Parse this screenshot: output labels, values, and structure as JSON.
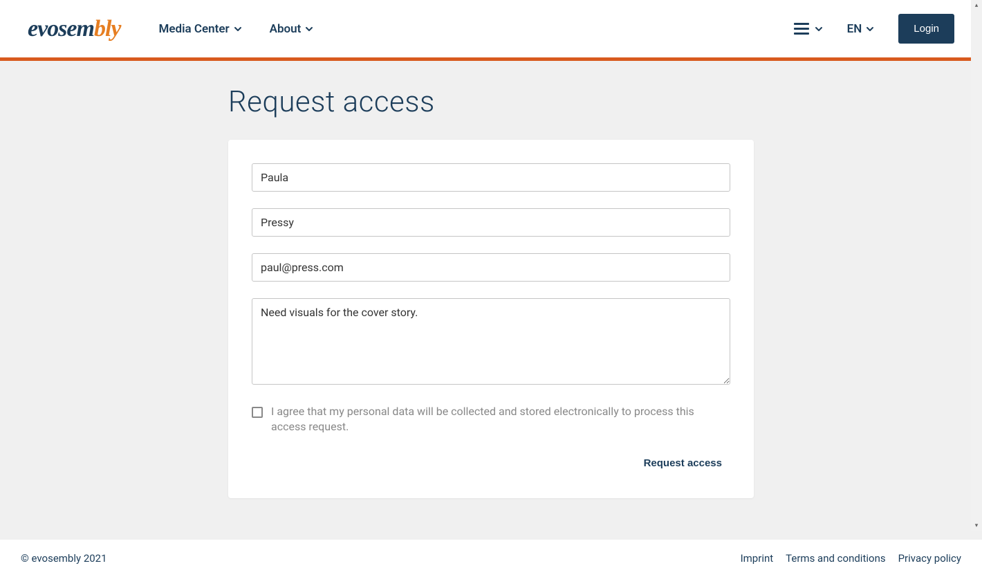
{
  "brand": {
    "part1": "evosem",
    "part2": "bly"
  },
  "nav": {
    "media": "Media Center",
    "about": "About"
  },
  "lang": "EN",
  "login": "Login",
  "page": {
    "title": "Request access"
  },
  "form": {
    "firstname": "Paula",
    "lastname": "Pressy",
    "email": "paul@press.com",
    "message": "Need visuals for the cover story.",
    "consent_label": "I agree that my personal data will be collected and stored electronically to process this access request.",
    "submit": "Request access"
  },
  "footer": {
    "copyright": "© evosembly 2021",
    "links": {
      "imprint": "Imprint",
      "terms": "Terms and conditions",
      "privacy": "Privacy policy"
    }
  }
}
